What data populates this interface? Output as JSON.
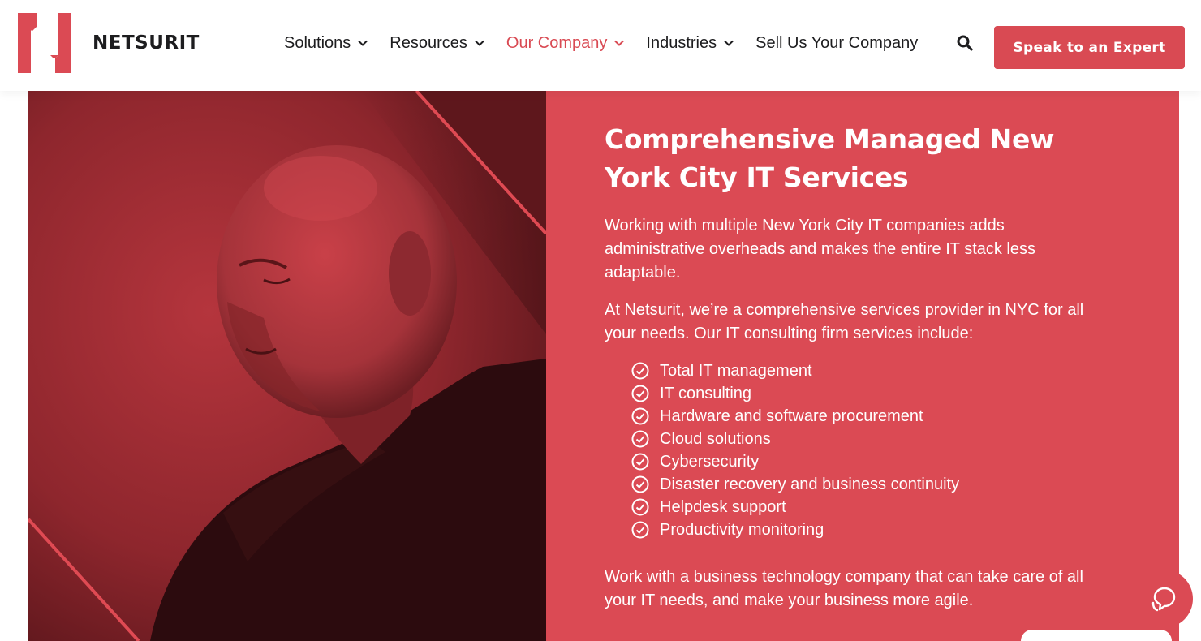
{
  "brand": {
    "name": "NETSURIT",
    "logo_icon": "netsurit-n-logo",
    "accent_color": "#d94a53"
  },
  "nav": {
    "items": [
      {
        "label": "Solutions",
        "has_dropdown": true,
        "active": false
      },
      {
        "label": "Resources",
        "has_dropdown": true,
        "active": false
      },
      {
        "label": "Our Company",
        "has_dropdown": true,
        "active": true
      },
      {
        "label": "Industries",
        "has_dropdown": true,
        "active": false
      },
      {
        "label": "Sell Us Your Company",
        "has_dropdown": false,
        "active": false
      }
    ],
    "search_icon": "search-icon",
    "cta_label": "Speak to an Expert"
  },
  "hero": {
    "title": "Comprehensive Managed New York City IT Services",
    "paragraph_1": "Working with multiple New York City IT companies adds administrative overheads and makes the entire IT stack less adaptable.",
    "paragraph_2": "At Netsurit, we’re a comprehensive services provider in NYC for all your needs. Our IT consulting firm services include:",
    "services": [
      "Total IT management",
      "IT consulting",
      "Hardware and software procurement",
      "Cloud solutions",
      "Cybersecurity",
      "Disaster recovery and business continuity",
      "Helpdesk support",
      "Productivity monitoring"
    ],
    "closing": "Work with a business technology company that can take care of all your IT needs, and make your business more agile.",
    "panel_color": "#db4a54"
  },
  "chat": {
    "icon": "chat-bubbles-icon"
  }
}
